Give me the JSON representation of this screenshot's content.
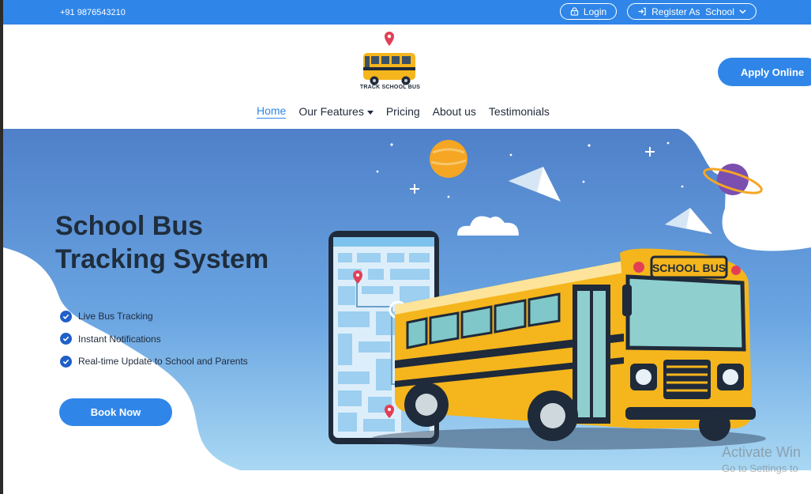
{
  "topbar": {
    "phone": "+91 9876543210",
    "login_label": "Login",
    "register_label": "Register As  School"
  },
  "header": {
    "logo_text": "TRACK SCHOOL BUS",
    "apply_label": "Apply Online"
  },
  "nav": {
    "items": [
      {
        "label": "Home",
        "active": true
      },
      {
        "label": "Our Features",
        "has_dropdown": true
      },
      {
        "label": "Pricing"
      },
      {
        "label": "About us"
      },
      {
        "label": "Testimonials"
      }
    ]
  },
  "hero": {
    "title_line1": "School Bus",
    "title_line2": "Tracking System",
    "features": [
      "Live Bus Tracking",
      "Instant Notifications",
      "Real-time Update to School and Parents"
    ],
    "book_label": "Book Now",
    "bus_sign": "SCHOOL BUS"
  },
  "watermark": {
    "line1": "Activate Win",
    "line2": "Go to Settings to"
  },
  "colors": {
    "primary": "#2f86e8",
    "dark_text": "#1f2d3d",
    "check": "#1f5fc8",
    "bus_yellow": "#f5b51c",
    "pin_red": "#e23f57"
  }
}
